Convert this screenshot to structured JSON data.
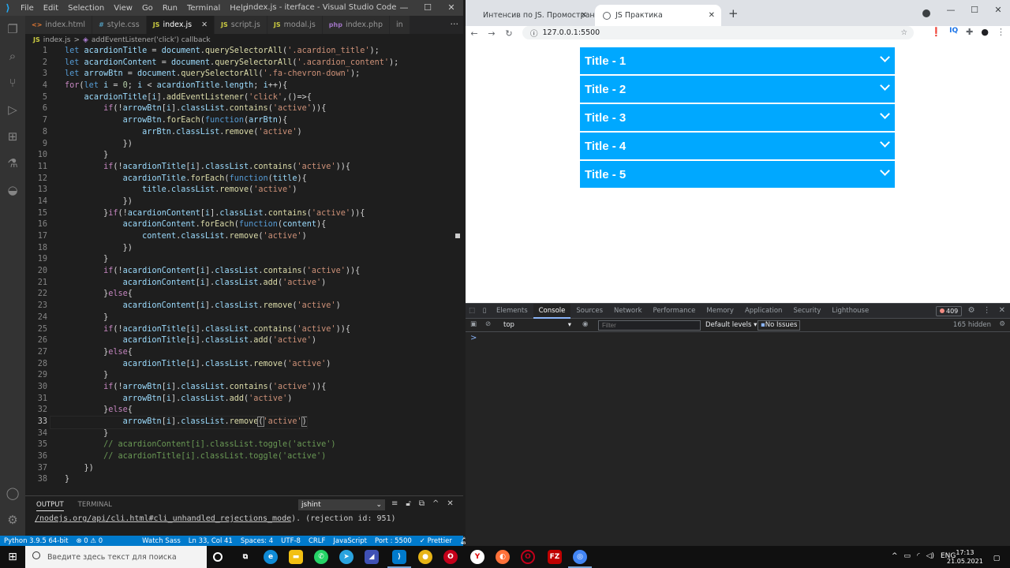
{
  "vscode": {
    "window_title": "index.js - iterface - Visual Studio Code",
    "menu": [
      "File",
      "Edit",
      "Selection",
      "View",
      "Go",
      "Run",
      "Terminal",
      "Help"
    ],
    "tabs": [
      {
        "icon": "<>",
        "label": "index.html"
      },
      {
        "icon": "#",
        "label": "style.css"
      },
      {
        "icon": "JS",
        "label": "index.js"
      },
      {
        "icon": "JS",
        "label": "script.js"
      },
      {
        "icon": "JS",
        "label": "modal.js"
      },
      {
        "icon": "php",
        "label": "index.php"
      },
      {
        "icon": "",
        "label": "in"
      }
    ],
    "breadcrumb": {
      "file": "index.js",
      "sep": ">",
      "symbol": "addEventListener('click') callback"
    },
    "code_lines": [
      "1",
      "2",
      "3",
      "4",
      "5",
      "6",
      "7",
      "8",
      "9",
      "10",
      "11",
      "12",
      "13",
      "14",
      "15",
      "16",
      "17",
      "18",
      "19",
      "20",
      "21",
      "22",
      "23",
      "24",
      "25",
      "26",
      "27",
      "28",
      "29",
      "30",
      "31",
      "32",
      "33",
      "34",
      "35",
      "36",
      "37",
      "38"
    ],
    "panel": {
      "tab_output": "OUTPUT",
      "tab_terminal": "TERMINAL",
      "channel": "jshint",
      "output_link": "/nodejs.org/api/cli.html#cli_unhandled_rejections_mode",
      "output_rest": "). (rejection id: 951)"
    },
    "status": {
      "python": "Python 3.9.5 64-bit",
      "problems": "⊗ 0 ⚠ 0",
      "watch_sass": "Watch Sass",
      "position": "Ln 33, Col 41",
      "spaces": "Spaces: 4",
      "encoding": "UTF-8",
      "eol": "CRLF",
      "language": "JavaScript",
      "port": "Port : 5500",
      "prettier": "✓ Prettier"
    }
  },
  "browser": {
    "tabs": [
      {
        "label": "Интенсив по JS. Промостраниц"
      },
      {
        "label": "JS Практика"
      }
    ],
    "url": "127.0.0.1:5500",
    "accordion": [
      {
        "title": "Title - 1"
      },
      {
        "title": "Title - 2"
      },
      {
        "title": "Title - 3"
      },
      {
        "title": "Title - 4"
      },
      {
        "title": "Title - 5"
      }
    ],
    "accent": "#00a8ff",
    "devtools": {
      "tabs": [
        "Elements",
        "Console",
        "Sources",
        "Network",
        "Performance",
        "Memory",
        "Application",
        "Security",
        "Lighthouse"
      ],
      "active_tab": "Console",
      "error_count": "409",
      "context": "top",
      "filter_placeholder": "Filter",
      "levels": "Default levels ▾",
      "issues": "No Issues",
      "hidden": "165 hidden",
      "prompt": ">"
    }
  },
  "taskbar": {
    "search_placeholder": "Введите здесь текст для поиска",
    "lang": "ENG",
    "time": "17:13",
    "date": "21.05.2021"
  }
}
